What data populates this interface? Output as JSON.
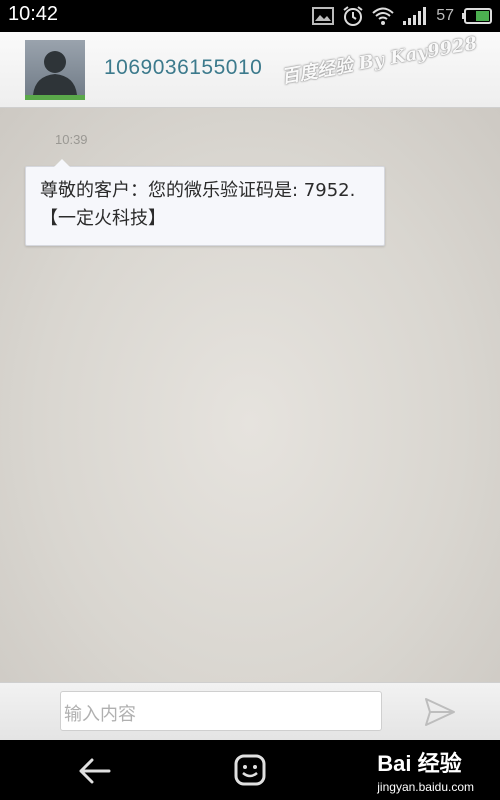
{
  "status_bar": {
    "time": "10:42",
    "battery_percent": "57",
    "icons": [
      "image-icon",
      "alarm-icon",
      "wifi-icon",
      "signal-icon",
      "battery-icon"
    ]
  },
  "header": {
    "contact_number": "1069036155010",
    "watermark": "百度经验 By Kay9928",
    "avatar_icon": "default-contact-icon"
  },
  "conversation": {
    "messages": [
      {
        "time": "10:39",
        "text": "尊敬的客户：您的微乐验证码是: 7952.【一定火科技】"
      }
    ]
  },
  "compose": {
    "placeholder": "输入内容",
    "send_icon": "send-icon"
  },
  "navbar": {
    "back_icon": "back-arrow-icon",
    "menu_icon": "smiley-menu-icon",
    "brand_logo": "Bai 经验",
    "brand_url": "jingyan.baidu.com"
  },
  "colors": {
    "contact_text": "#3c7a8c",
    "avatar_bar": "#5aa84a",
    "bubble_bg": "#f6f7fb",
    "battery_green": "#4caf50"
  }
}
